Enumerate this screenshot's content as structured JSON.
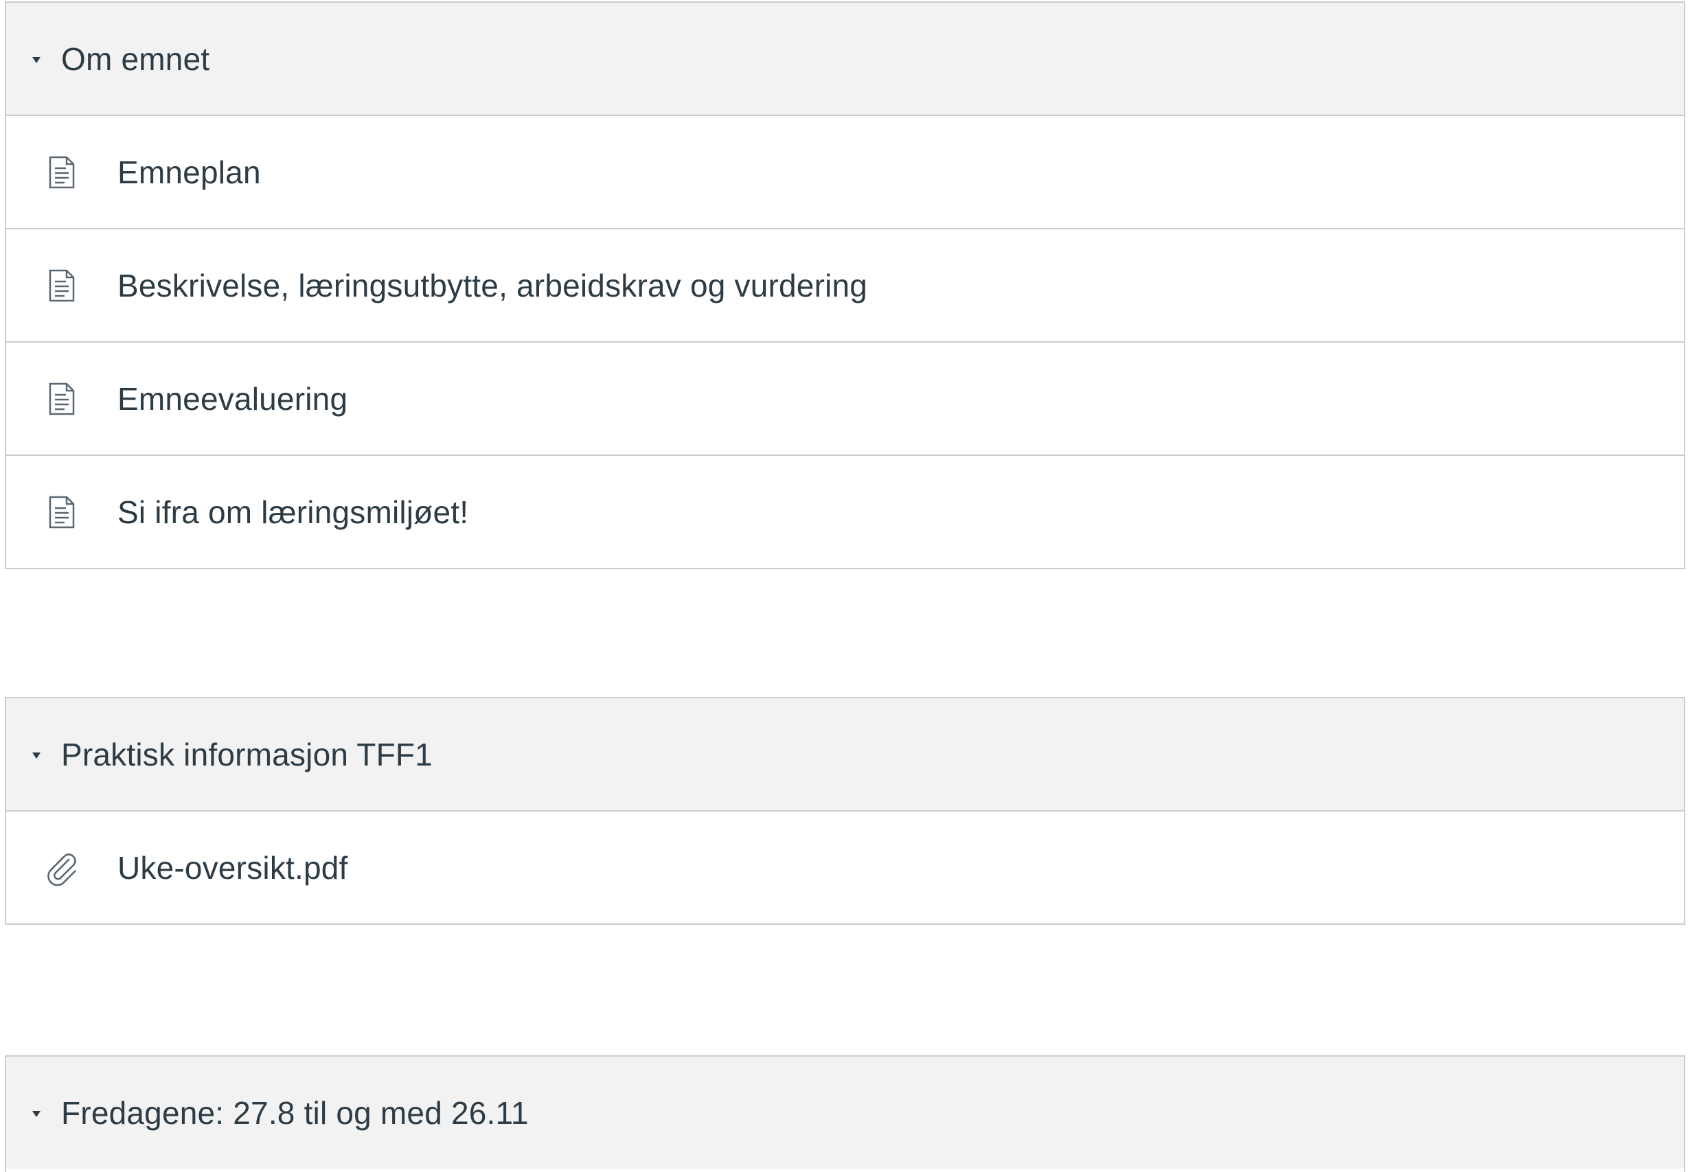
{
  "modules": [
    {
      "title": "Om emnet",
      "items": [
        {
          "label": "Emneplan",
          "icon": "document-icon"
        },
        {
          "label": "Beskrivelse, læringsutbytte, arbeidskrav og vurdering",
          "icon": "document-icon"
        },
        {
          "label": "Emneevaluering",
          "icon": "document-icon"
        },
        {
          "label": "Si ifra om læringsmiljøet!",
          "icon": "document-icon"
        }
      ]
    },
    {
      "title": "Praktisk informasjon TFF1",
      "items": [
        {
          "label": "Uke-oversikt.pdf",
          "icon": "paperclip-icon"
        }
      ]
    },
    {
      "title": "Fredagene: 27.8 til og med 26.11",
      "items": []
    }
  ],
  "colors": {
    "header_bg": "#f2f2f2",
    "border": "#c7cdd1",
    "text": "#2d3b45"
  }
}
